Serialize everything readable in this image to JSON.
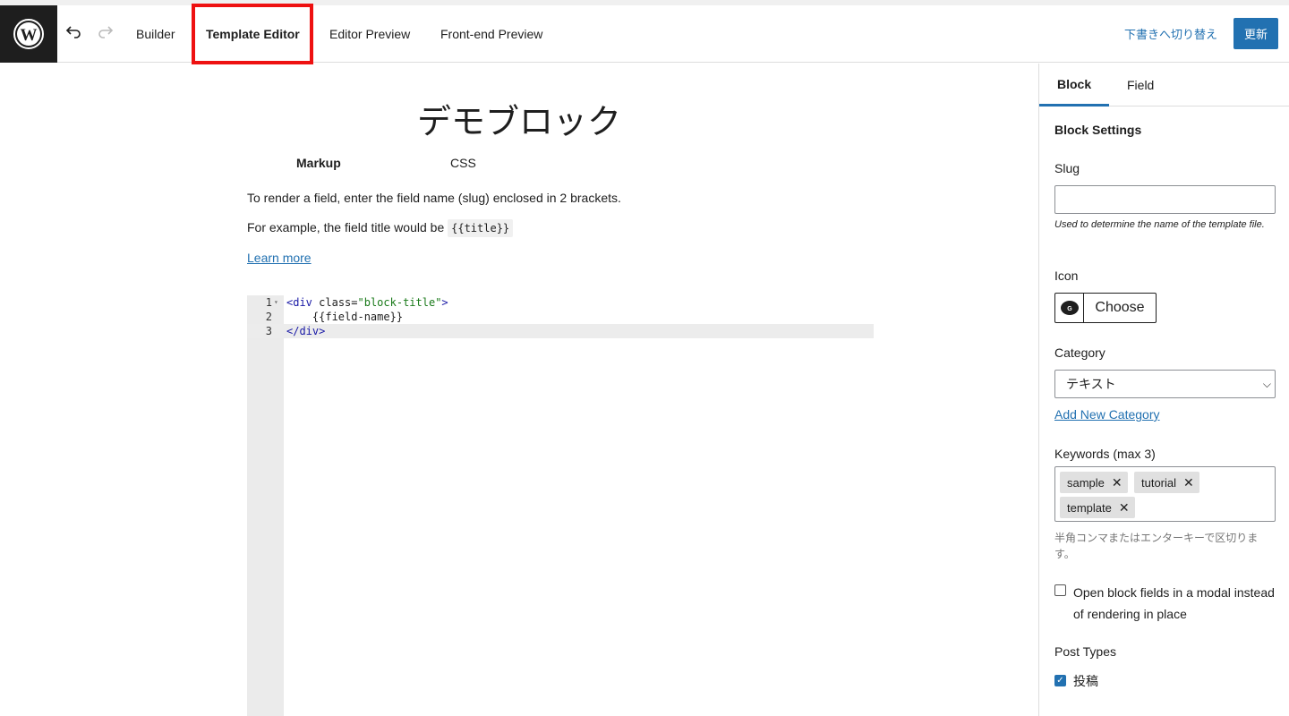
{
  "toolbar": {
    "tabs": [
      "Builder",
      "Template Editor",
      "Editor Preview",
      "Front-end Preview"
    ],
    "switch_to_draft": "下書きへ切り替え",
    "update": "更新"
  },
  "main": {
    "title": "デモブロック",
    "subtabs": [
      "Markup",
      "CSS"
    ],
    "info_line1": "To render a field, enter the field name (slug) enclosed in 2 brackets.",
    "info_line2_prefix": "For example, the field title would be",
    "info_line2_code": "{{title}}",
    "learn_more": "Learn more",
    "code_lines": [
      {
        "n": "1",
        "text": "<div class=\"block-title\">"
      },
      {
        "n": "2",
        "text": "    {{field-name}}"
      },
      {
        "n": "3",
        "text": "</div>"
      }
    ]
  },
  "sidebar": {
    "tabs": [
      "Block",
      "Field"
    ],
    "heading": "Block Settings",
    "slug_label": "Slug",
    "slug_value": "",
    "slug_help": "Used to determine the name of the template file.",
    "icon_label": "Icon",
    "icon_choose": "Choose",
    "category_label": "Category",
    "category_value": "テキスト",
    "add_category": "Add New Category",
    "keywords_label": "Keywords (max 3)",
    "keywords": [
      "sample",
      "tutorial",
      "template"
    ],
    "keywords_hint": "半角コンマまたはエンターキーで区切ります。",
    "modal_option": "Open block fields in a modal instead of rendering in place",
    "modal_checked": false,
    "post_types_label": "Post Types",
    "post_types": [
      {
        "label": "投稿",
        "checked": true
      }
    ]
  },
  "colors": {
    "accent": "#2271b1",
    "highlight": "#e11111"
  }
}
